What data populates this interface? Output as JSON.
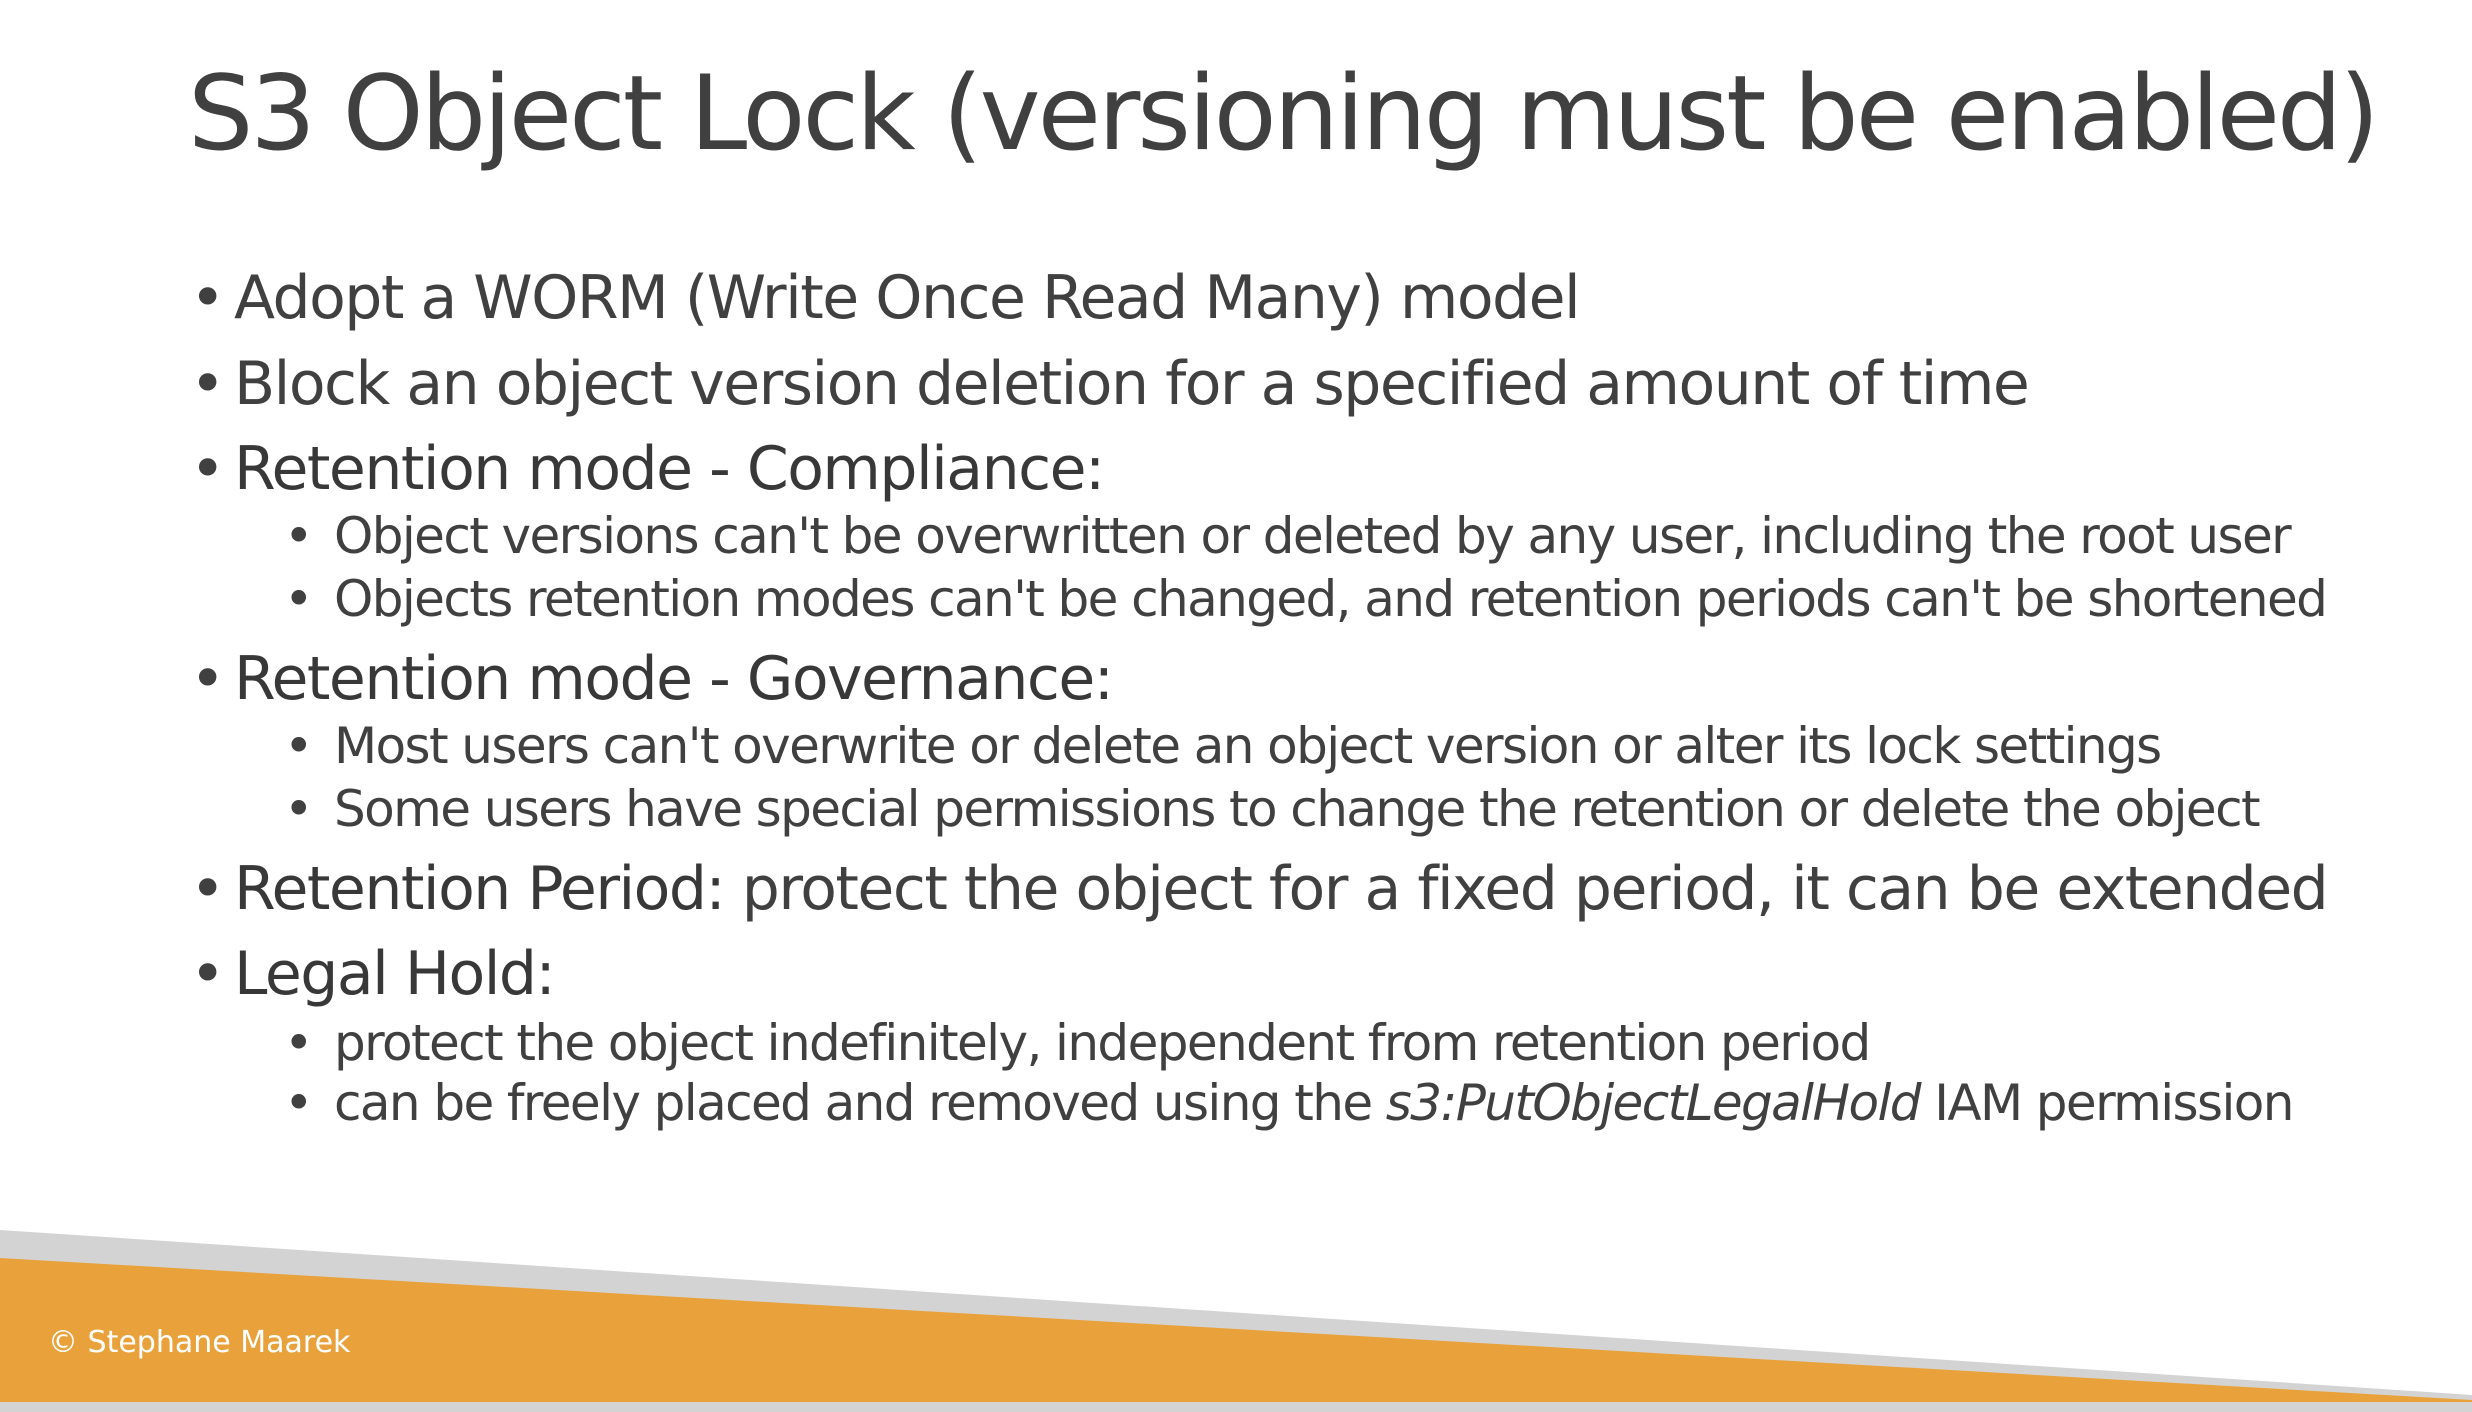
{
  "slide": {
    "title": "S3 Object Lock (versioning must be enabled)",
    "bullets": {
      "worm": "Adopt a WORM (Write Once Read Many) model",
      "block": "Block an object version deletion for a specified amount of time",
      "compliance_heading": "Retention mode - Compliance:",
      "compliance_sub1": "Object versions can't be overwritten or deleted by any user, including the root user",
      "compliance_sub2": "Objects retention modes can't be changed, and retention periods can't be shortened",
      "governance_heading": "Retention mode - Governance:",
      "governance_sub1": "Most users can't overwrite or delete an object version or alter its lock settings",
      "governance_sub2": "Some users have special permissions to change the retention or delete the object",
      "retention_period_term": "Retention Period:",
      "retention_period_text": " protect the object for a fixed period, it can be extended",
      "legal_hold_heading": "Legal Hold:",
      "legal_hold_sub1": "protect the object indefinitely, independent from retention period",
      "legal_hold_sub2_prefix": "can be freely placed and removed using the ",
      "legal_hold_sub2_permission": "s3:PutObjectLegalHold",
      "legal_hold_sub2_suffix": " IAM permission"
    },
    "bullet_glyph": "•"
  },
  "footer": {
    "copyright": "© Stephane Maarek"
  },
  "colors": {
    "text": "#404040",
    "footer_orange": "#E9A23B",
    "footer_gray": "#D3D3D3",
    "background": "#FFFFFF"
  }
}
